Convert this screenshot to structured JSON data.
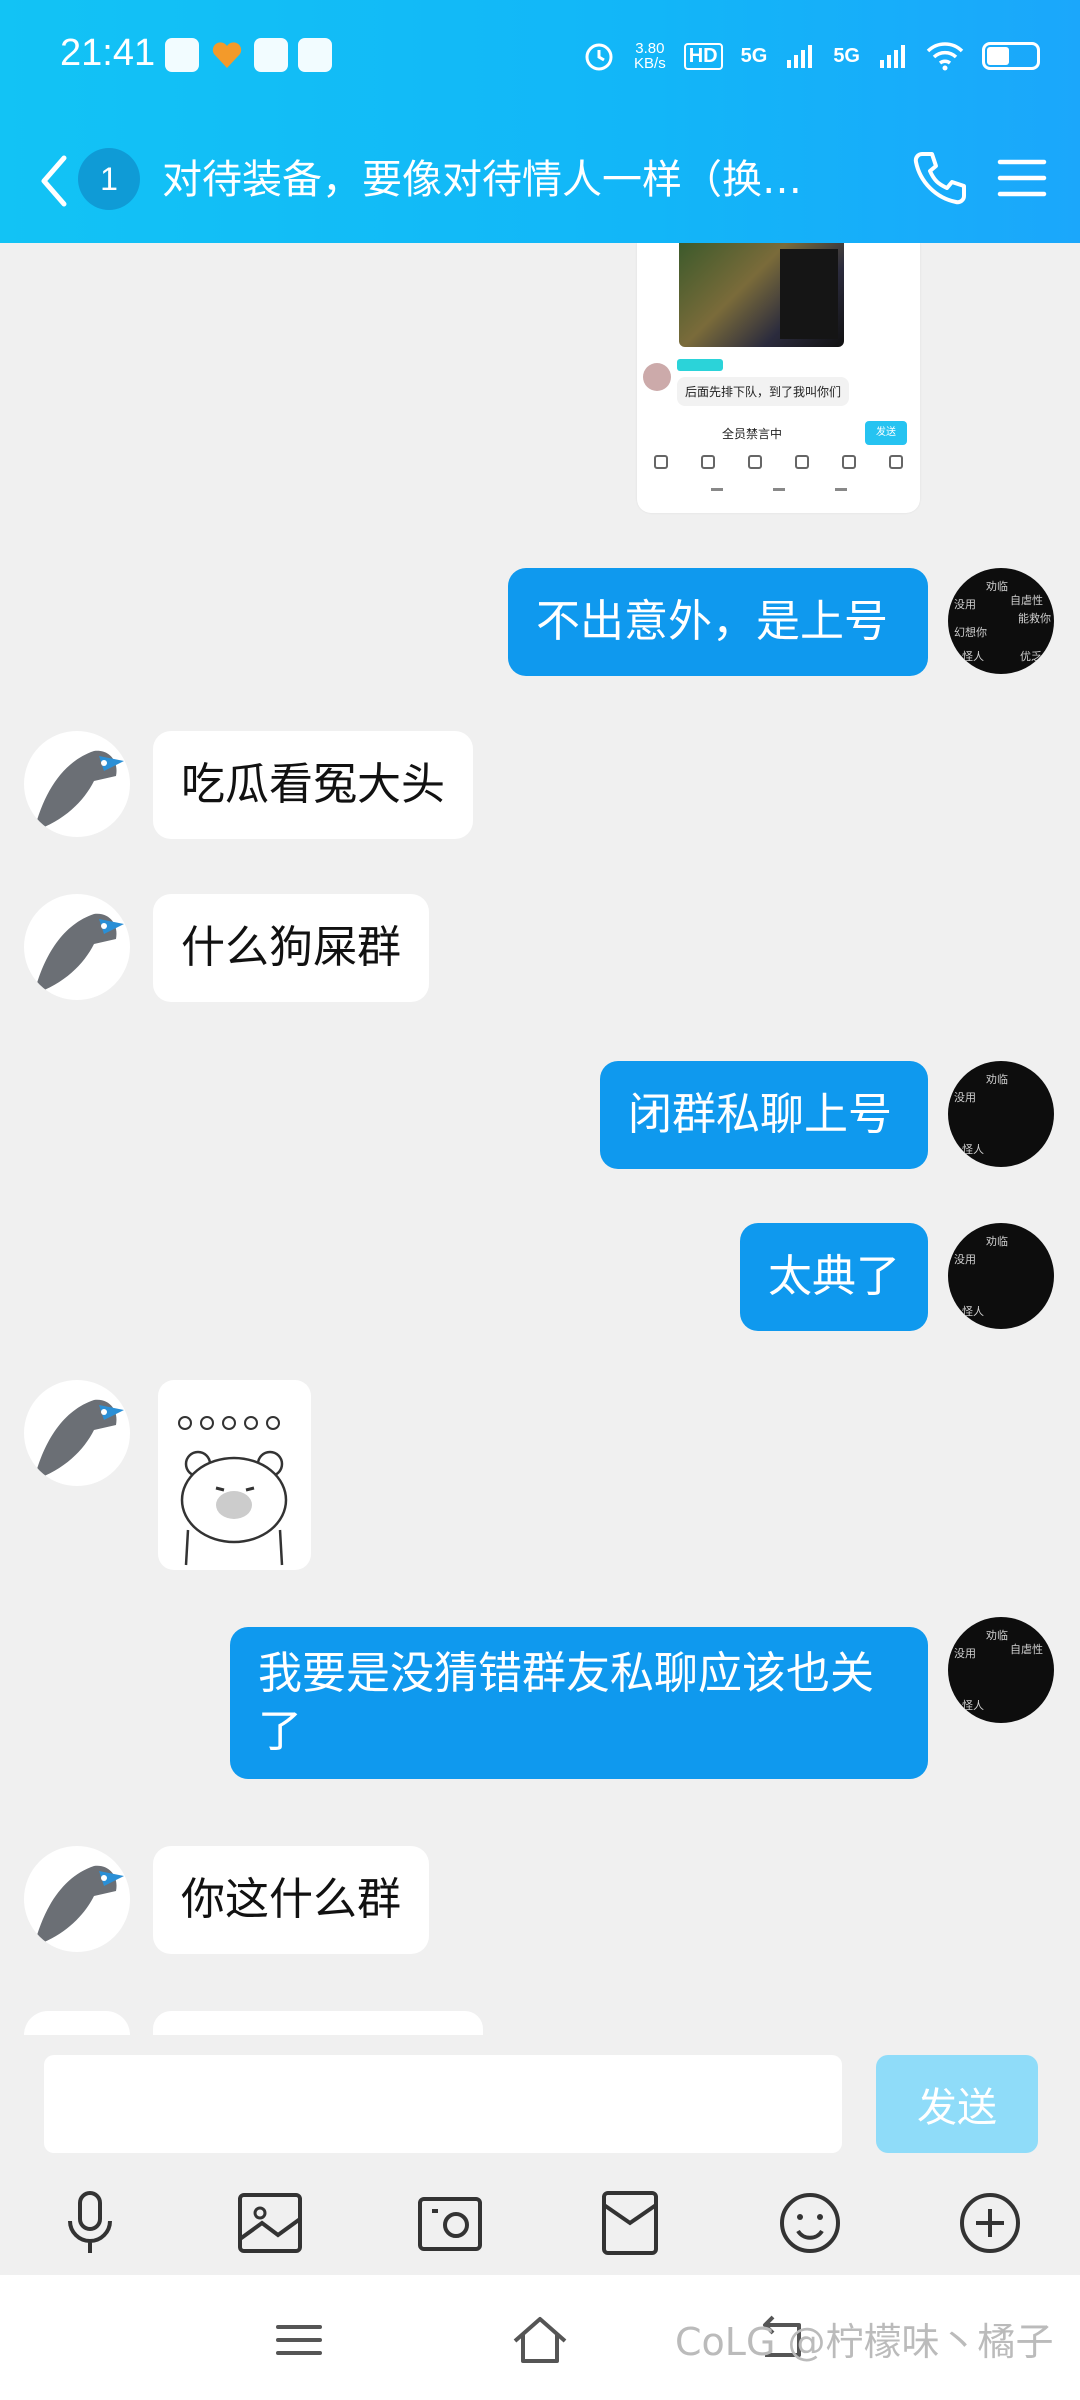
{
  "status_bar": {
    "time": "21:41",
    "network_speed_value": "3.80",
    "network_speed_unit": "KB/s",
    "hd_label": "HD",
    "signal_1": "5G",
    "signal_2": "5G",
    "icons": [
      "app-notification-icon",
      "heart-app-icon",
      "message-app-icon",
      "tiktok-app-icon",
      "alarm-icon",
      "hd-icon",
      "signal-icon",
      "wifi-icon",
      "battery-icon"
    ]
  },
  "header": {
    "unread_count": "1",
    "title": "对待装备，要像对待情人一样（换…"
  },
  "screenshot_preview": {
    "tag": "",
    "message": "后面先排下队，到了我叫你们",
    "banner": "全员禁言中",
    "send": "发送"
  },
  "messages": [
    {
      "side": "right",
      "text": "不出意外，是上号"
    },
    {
      "side": "left",
      "text": "吃瓜看冤大头"
    },
    {
      "side": "left",
      "text": "什么狗屎群"
    },
    {
      "side": "right",
      "text": "闭群私聊上号"
    },
    {
      "side": "right",
      "text": "太典了"
    },
    {
      "side": "left",
      "type": "sticker"
    },
    {
      "side": "right",
      "text": "我要是没猜错群友私聊应该也关了"
    },
    {
      "side": "left",
      "text": "你这什么群"
    }
  ],
  "self_avatar_text": [
    "劝临",
    "自虐性",
    "没用",
    "能救你",
    "幻想你",
    "怪人",
    "亲爱",
    "优乏"
  ],
  "input": {
    "placeholder": "",
    "value": "",
    "send_label": "发送"
  },
  "toolbar_icons": [
    "microphone-icon",
    "image-icon",
    "camera-icon",
    "red-packet-icon",
    "emoji-icon",
    "plus-icon"
  ],
  "watermark": "CoLG @柠檬味丶橘子",
  "colors": {
    "header_start": "#12c3f5",
    "header_end": "#1ba7fb",
    "bubble_self": "#0f99ee",
    "bubble_other": "#ffffff",
    "send_disabled": "#8fdcf9",
    "chat_background": "#f0f0f0"
  }
}
